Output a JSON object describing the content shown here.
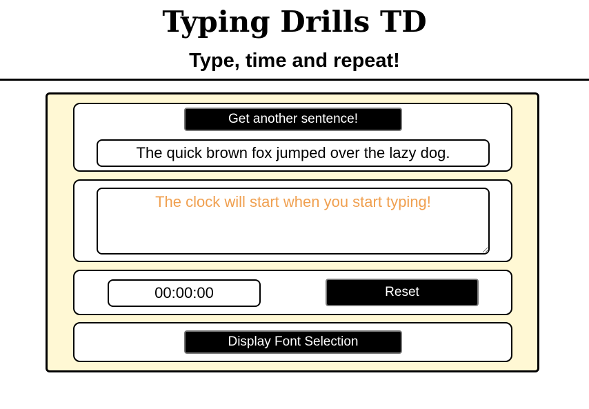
{
  "header": {
    "title": "Typing Drills TD",
    "subtitle": "Type, time and repeat!"
  },
  "sentence_section": {
    "button_label": "Get another sentence!",
    "sentence": "The quick brown fox jumped over the lazy dog."
  },
  "typing_section": {
    "value": "",
    "placeholder": "The clock will start when you start typing!"
  },
  "timer_section": {
    "time": "00:00:00",
    "reset_label": "Reset"
  },
  "font_section": {
    "button_label": "Display Font Selection"
  },
  "colors": {
    "panel_background": "#fff8d4",
    "placeholder_text": "#f0a050",
    "button_background": "#000000",
    "button_text": "#ffffff"
  }
}
